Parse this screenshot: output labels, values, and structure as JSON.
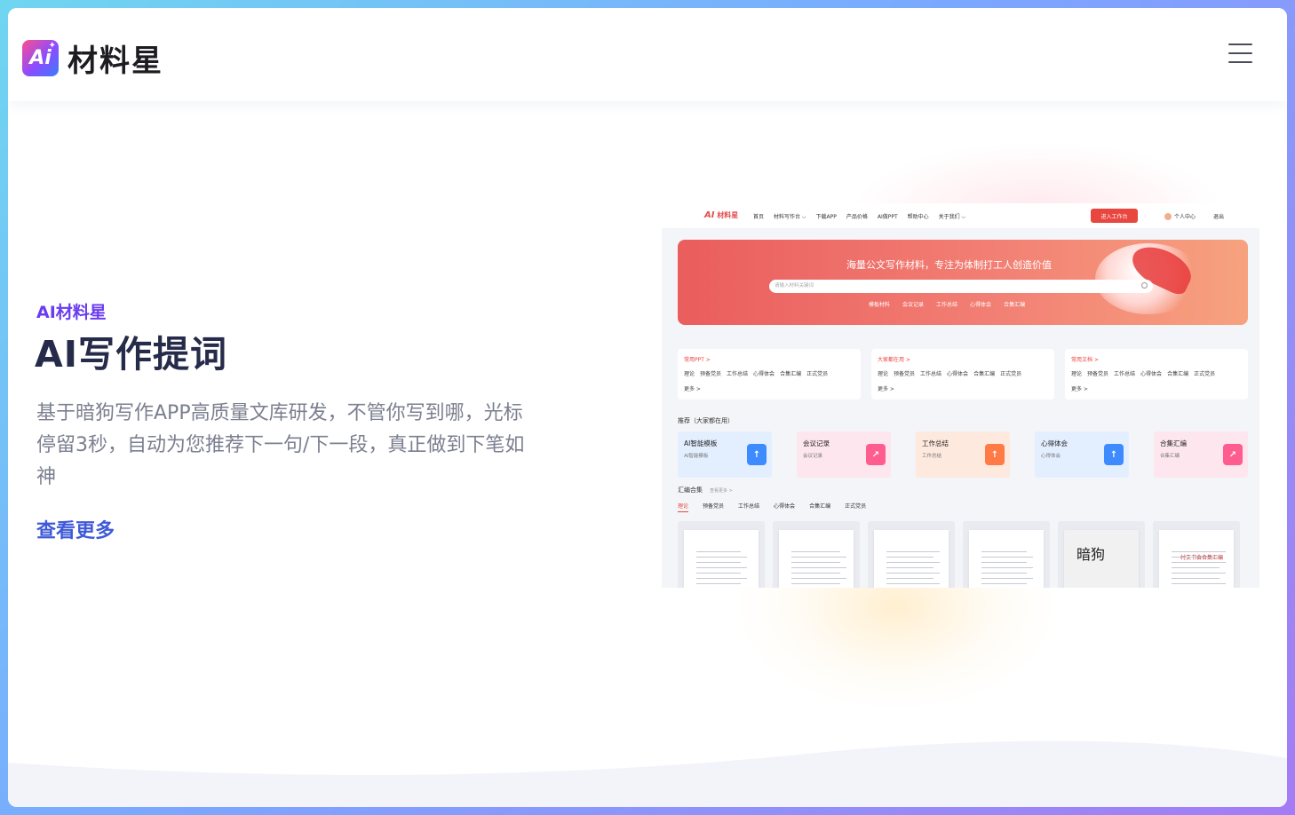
{
  "brand": {
    "badge": "Ai",
    "name": "材料星"
  },
  "hero": {
    "label": "AI材料星",
    "title": "AI写作提词",
    "description": "基于暗狗写作APP高质量文库研发，不管你写到哪，光标停留3秒，自动为您推荐下一句/下一段，真正做到下笔如神",
    "link": "查看更多"
  },
  "preview": {
    "logo": "材料星",
    "logo_mark": "AI",
    "nav": [
      "首页",
      "材料写作台 ⌵",
      "下载APP",
      "产品价格",
      "AI做PPT",
      "帮助中心",
      "关于我们 ⌵"
    ],
    "workspace_button": "进入工作台",
    "user": "个人中心",
    "exit": "退出",
    "banner_title": "海量公文写作材料，专注为体制打工人创造价值",
    "search_placeholder": "请输入材料关键词",
    "banner_tags": [
      "模板材料",
      "会议记录",
      "工作总结",
      "心得体会",
      "合集汇编"
    ],
    "cards": [
      {
        "title": "常用PPT >",
        "items": [
          "理论",
          "预备党员",
          "工作总结",
          "心得体会",
          "合集汇编",
          "正式党员"
        ],
        "more": "更多 >"
      },
      {
        "title": "大家都在用 >",
        "items": [
          "理论",
          "预备党员",
          "工作总结",
          "心得体会",
          "合集汇编",
          "正式党员"
        ],
        "more": "更多 >"
      },
      {
        "title": "常用文档 >",
        "items": [
          "理论",
          "预备党员",
          "工作总结",
          "心得体会",
          "合集汇编",
          "正式党员"
        ],
        "more": "更多 >"
      }
    ],
    "recommend_title": "推荐（大家都在用）",
    "tiles": [
      {
        "title": "AI智能模板",
        "sub": "AI智能模板",
        "bg": "#e3efff",
        "icon_bg": "#3e8bff",
        "icon": "↑"
      },
      {
        "title": "会议记录",
        "sub": "会议记录",
        "bg": "#fde6ee",
        "icon_bg": "#ff5c8f",
        "icon": "↗"
      },
      {
        "title": "工作总结",
        "sub": "工作总结",
        "bg": "#fde9de",
        "icon_bg": "#ff7a45",
        "icon": "↑"
      },
      {
        "title": "心得体会",
        "sub": "心得体会",
        "bg": "#e3efff",
        "icon_bg": "#3e8bff",
        "icon": "↑"
      },
      {
        "title": "合集汇编",
        "sub": "合集汇编",
        "bg": "#fde6ee",
        "icon_bg": "#ff5c8f",
        "icon": "↗"
      }
    ],
    "collection_title": "汇编合集",
    "collection_more": "查看更多 >",
    "tabs": [
      "理论",
      "预备党员",
      "工作总结",
      "心得体会",
      "合集汇编",
      "正式党员"
    ],
    "doc_cover_big": "暗狗",
    "doc_cover_red": "村支书会合集汇编"
  }
}
